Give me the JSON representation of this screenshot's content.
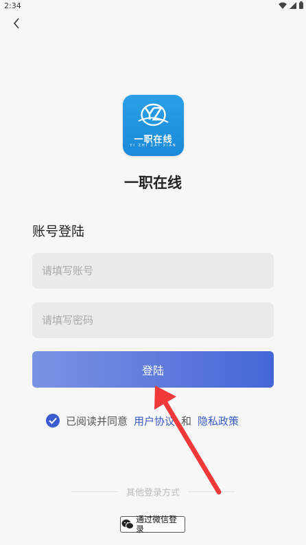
{
  "status": {
    "time": "2:34"
  },
  "app": {
    "name": "一职在线",
    "logo_text": "一职在线",
    "logo_sub": "YI ZHI ZAI XIAN",
    "logo_mark": "YZ"
  },
  "form": {
    "title": "账号登陆",
    "account_placeholder": "请填写账号",
    "password_placeholder": "请填写密码",
    "login_label": "登陆"
  },
  "agreement": {
    "prefix": "已阅读并同意",
    "user_agreement": "用户协议",
    "and": "和",
    "privacy_policy": "隐私政策"
  },
  "other": {
    "divider_text": "其他登录方式",
    "wechat_label": "通过微信登录"
  },
  "colors": {
    "accent": "#4566d7",
    "link": "#3a5bc9",
    "logo_bg": "#2a9fe6",
    "annotation": "#f03a3a"
  },
  "icons": [
    "back-chevron-icon",
    "wifi-icon",
    "signal-icon",
    "battery-icon",
    "check-circle-icon",
    "wechat-icon",
    "annotation-arrow"
  ]
}
